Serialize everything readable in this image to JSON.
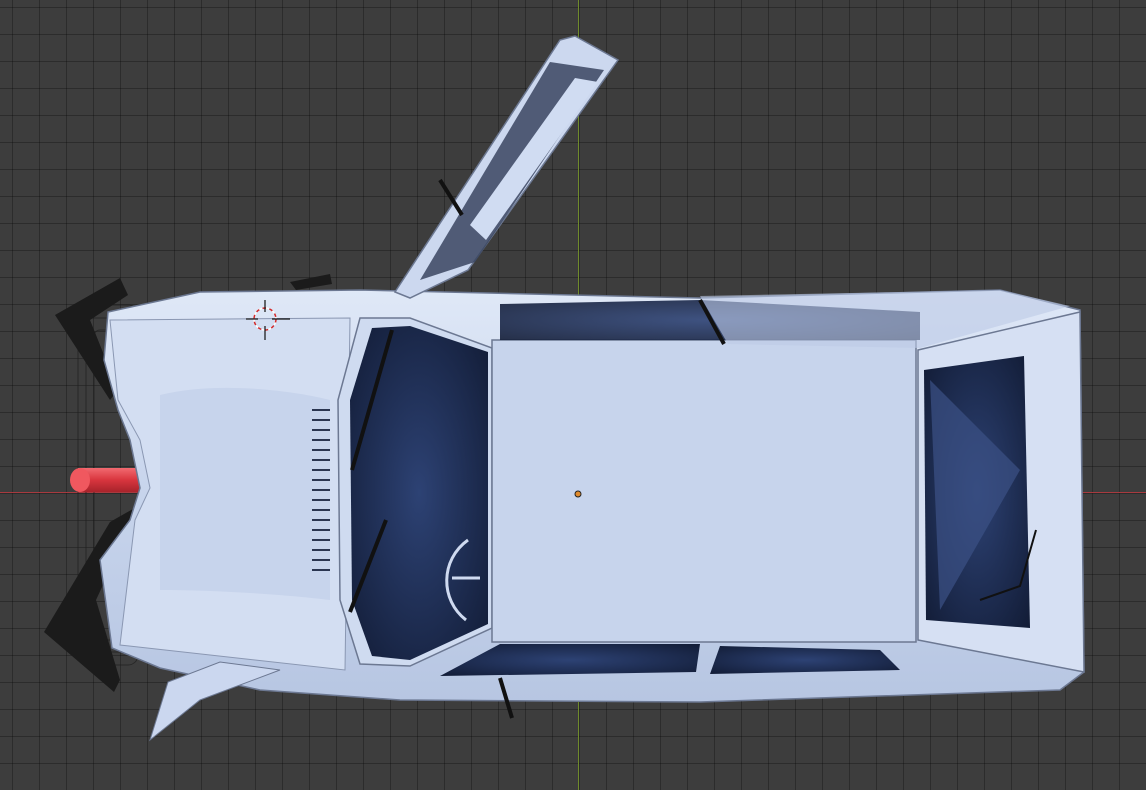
{
  "viewport": {
    "background_color": "#3d3d3d",
    "grid_color": "#333333",
    "x_axis_color": "#a83a3f",
    "y_axis_color": "#6f8a2c"
  },
  "scene": {
    "object": "car-model-top-view",
    "body_color": "#c8d6ee",
    "glass_color": "#1d2d52",
    "tire_color": "#1a1a1a",
    "exhaust_color": "#e0444c",
    "origin_color": "#e08a2c",
    "cursor_color": "#d42a2a"
  }
}
